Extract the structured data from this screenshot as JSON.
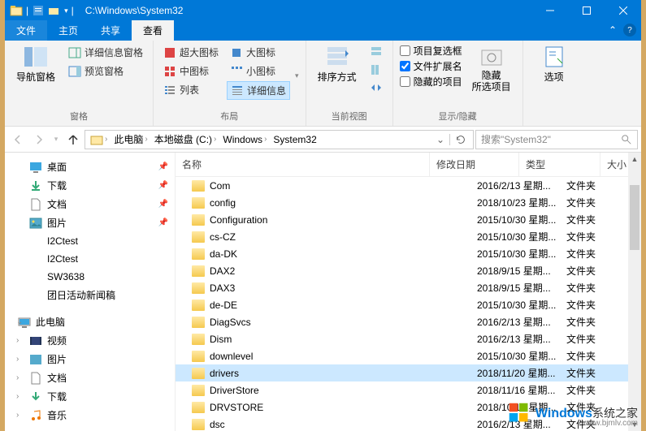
{
  "title": "C:\\Windows\\System32",
  "tabs": {
    "file": "文件",
    "home": "主页",
    "share": "共享",
    "view": "查看"
  },
  "ribbon": {
    "panes": {
      "nav_pane": "导航窗格",
      "preview_pane": "预览窗格",
      "details_pane": "详细信息窗格",
      "label": "窗格"
    },
    "layout": {
      "xl_icons": "超大图标",
      "l_icons": "大图标",
      "m_icons": "中图标",
      "s_icons": "小图标",
      "list": "列表",
      "details": "详细信息",
      "label": "布局"
    },
    "current": {
      "sort": "排序方式",
      "label": "当前视图"
    },
    "showhide": {
      "checkboxes": "项目复选框",
      "extensions": "文件扩展名",
      "hidden": "隐藏的项目",
      "hide_selected": "隐藏\n所选项目",
      "label": "显示/隐藏"
    },
    "options": "选项"
  },
  "breadcrumb": [
    "此电脑",
    "本地磁盘 (C:)",
    "Windows",
    "System32"
  ],
  "search_placeholder": "搜索\"System32\"",
  "nav": {
    "desktop": "桌面",
    "downloads": "下载",
    "documents": "文档",
    "pictures": "图片",
    "i2ctest": "I2Ctest",
    "sw3638": "SW3638",
    "activity": "团日活动新闻稿",
    "thispc": "此电脑",
    "videos": "视频",
    "pictures2": "图片",
    "documents2": "文档",
    "downloads2": "下载",
    "music": "音乐"
  },
  "columns": {
    "name": "名称",
    "date": "修改日期",
    "type": "类型",
    "size": "大小"
  },
  "files": [
    {
      "name": "Com",
      "date": "2016/2/13 星期...",
      "type": "文件夹"
    },
    {
      "name": "config",
      "date": "2018/10/23 星期...",
      "type": "文件夹"
    },
    {
      "name": "Configuration",
      "date": "2015/10/30 星期...",
      "type": "文件夹"
    },
    {
      "name": "cs-CZ",
      "date": "2015/10/30 星期...",
      "type": "文件夹"
    },
    {
      "name": "da-DK",
      "date": "2015/10/30 星期...",
      "type": "文件夹"
    },
    {
      "name": "DAX2",
      "date": "2018/9/15 星期...",
      "type": "文件夹"
    },
    {
      "name": "DAX3",
      "date": "2018/9/15 星期...",
      "type": "文件夹"
    },
    {
      "name": "de-DE",
      "date": "2015/10/30 星期...",
      "type": "文件夹"
    },
    {
      "name": "DiagSvcs",
      "date": "2016/2/13 星期...",
      "type": "文件夹"
    },
    {
      "name": "Dism",
      "date": "2016/2/13 星期...",
      "type": "文件夹"
    },
    {
      "name": "downlevel",
      "date": "2015/10/30 星期...",
      "type": "文件夹"
    },
    {
      "name": "drivers",
      "date": "2018/11/20 星期...",
      "type": "文件夹",
      "selected": true
    },
    {
      "name": "DriverStore",
      "date": "2018/11/16 星期...",
      "type": "文件夹"
    },
    {
      "name": "DRVSTORE",
      "date": "2018/10/12 星期...",
      "type": "文件夹"
    },
    {
      "name": "dsc",
      "date": "2016/2/13 星期...",
      "type": "文件夹"
    }
  ],
  "watermark": {
    "brand": "Windows",
    "suffix": "系统之家",
    "url": "www.bjmlv.com"
  }
}
